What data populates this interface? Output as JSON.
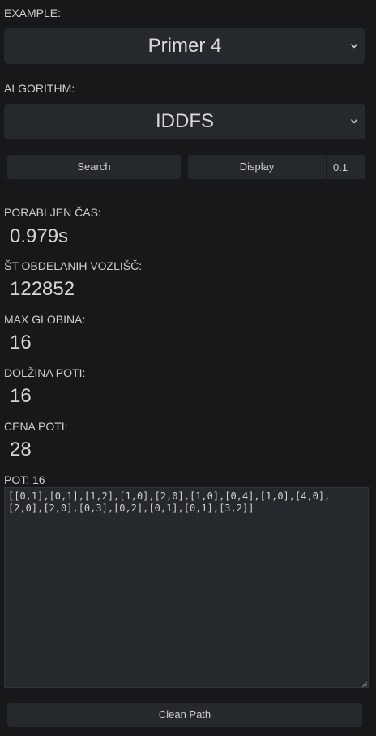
{
  "example": {
    "label": "EXAMPLE:",
    "selected": "Primer 4"
  },
  "algorithm": {
    "label": "ALGORITHM:",
    "selected": "IDDFS"
  },
  "controls": {
    "search_label": "Search",
    "display_label": "Display",
    "display_delay": "0.1"
  },
  "stats": {
    "time_label": "PORABLJEN ČAS:",
    "time_value": "0.979s",
    "nodes_label": "ŠT OBDELANIH VOZLIŠČ:",
    "nodes_value": "122852",
    "depth_label": "MAX GLOBINA:",
    "depth_value": "16",
    "path_length_label": "DOLŽINA POTI:",
    "path_length_value": "16",
    "path_cost_label": "CENA POTI:",
    "path_cost_value": "28"
  },
  "path": {
    "label": "POT: 16",
    "value": "[[0,1],[0,1],[1,2],[1,0],[2,0],[1,0],[0,4],[1,0],[4,0],\n[2,0],[2,0],[0,3],[0,2],[0,1],[0,1],[3,2]]"
  },
  "footer": {
    "clean_label": "Clean Path"
  },
  "icons": {
    "dropdown": "chevron-down-icon"
  }
}
